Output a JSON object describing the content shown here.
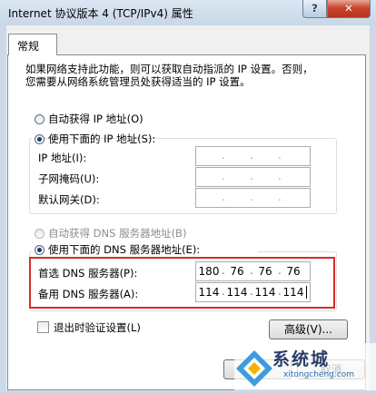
{
  "window": {
    "title": "Internet 协议版本 4 (TCP/IPv4) 属性",
    "help_glyph": "?",
    "close_glyph": "✕"
  },
  "tabs": [
    {
      "label": "常规"
    }
  ],
  "description": [
    "如果网络支持此功能，则可以获取自动指派的 IP 设置。否则，",
    "您需要从网络系统管理员处获得适当的 IP 设置。"
  ],
  "ip": {
    "auto_label": "自动获得 IP 地址(O)",
    "auto_selected": false,
    "manual_label": "使用下面的 IP 地址(S):",
    "manual_selected": true,
    "fields": [
      {
        "label": "IP 地址(I):",
        "octets": [
          "",
          "",
          "",
          ""
        ]
      },
      {
        "label": "子网掩码(U):",
        "octets": [
          "",
          "",
          "",
          ""
        ]
      },
      {
        "label": "默认网关(D):",
        "octets": [
          "",
          "",
          "",
          ""
        ]
      }
    ]
  },
  "dns": {
    "auto_label": "自动获得 DNS 服务器地址(B)",
    "auto_selected": false,
    "auto_disabled": true,
    "manual_label": "使用下面的 DNS 服务器地址(E):",
    "manual_selected": true,
    "fields": [
      {
        "label": "首选 DNS 服务器(P):",
        "octets": [
          "180",
          "76",
          "76",
          "76"
        ]
      },
      {
        "label": "备用 DNS 服务器(A):",
        "octets": [
          "114",
          "114",
          "114",
          "114"
        ]
      }
    ]
  },
  "validate": {
    "label": "退出时验证设置(L)",
    "checked": false
  },
  "advanced_button": "高级(V)...",
  "bottom_buttons": {
    "ok": "确定",
    "cancel": "取消"
  },
  "watermark": {
    "brand": "系统城",
    "url": "xitongcheng.com"
  },
  "colors": {
    "highlight_box": "#d92a2a",
    "title_bar": "#c8d7e7"
  }
}
